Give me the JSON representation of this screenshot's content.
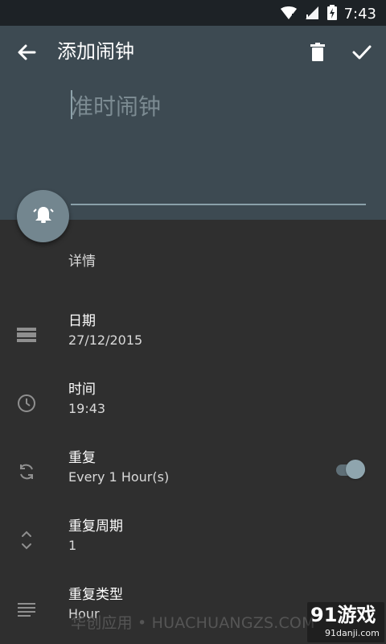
{
  "status": {
    "time": "7:43",
    "icons": [
      "wifi-icon",
      "cell-signal-icon",
      "battery-charging-icon"
    ]
  },
  "appbar": {
    "title": "添加闹钟",
    "back_icon": "back-arrow-icon",
    "delete_icon": "trash-icon",
    "confirm_icon": "check-icon"
  },
  "alarm_title": {
    "value": "",
    "placeholder": "准时闹钟"
  },
  "fab": {
    "icon": "bell-icon"
  },
  "details": {
    "label": "详情",
    "rows": [
      {
        "icon": "calendar-icon",
        "label": "日期",
        "value": "27/12/2015"
      },
      {
        "icon": "clock-icon",
        "label": "时间",
        "value": "19:43"
      },
      {
        "icon": "repeat-icon",
        "label": "重复",
        "value": "Every 1 Hour(s)",
        "toggle_on": true
      },
      {
        "icon": "unfold-icon",
        "label": "重复周期",
        "value": "1"
      },
      {
        "icon": "lines-icon",
        "label": "重复类型",
        "value": "Hour"
      }
    ]
  },
  "watermark": {
    "text": "华创应用 • HUACHUANGZS.COM",
    "logo": "91游戏",
    "sub": "91danji.com"
  },
  "colors": {
    "header": "#3d4a52",
    "body": "#2f2f2f",
    "accent": "#8aa0a9"
  }
}
